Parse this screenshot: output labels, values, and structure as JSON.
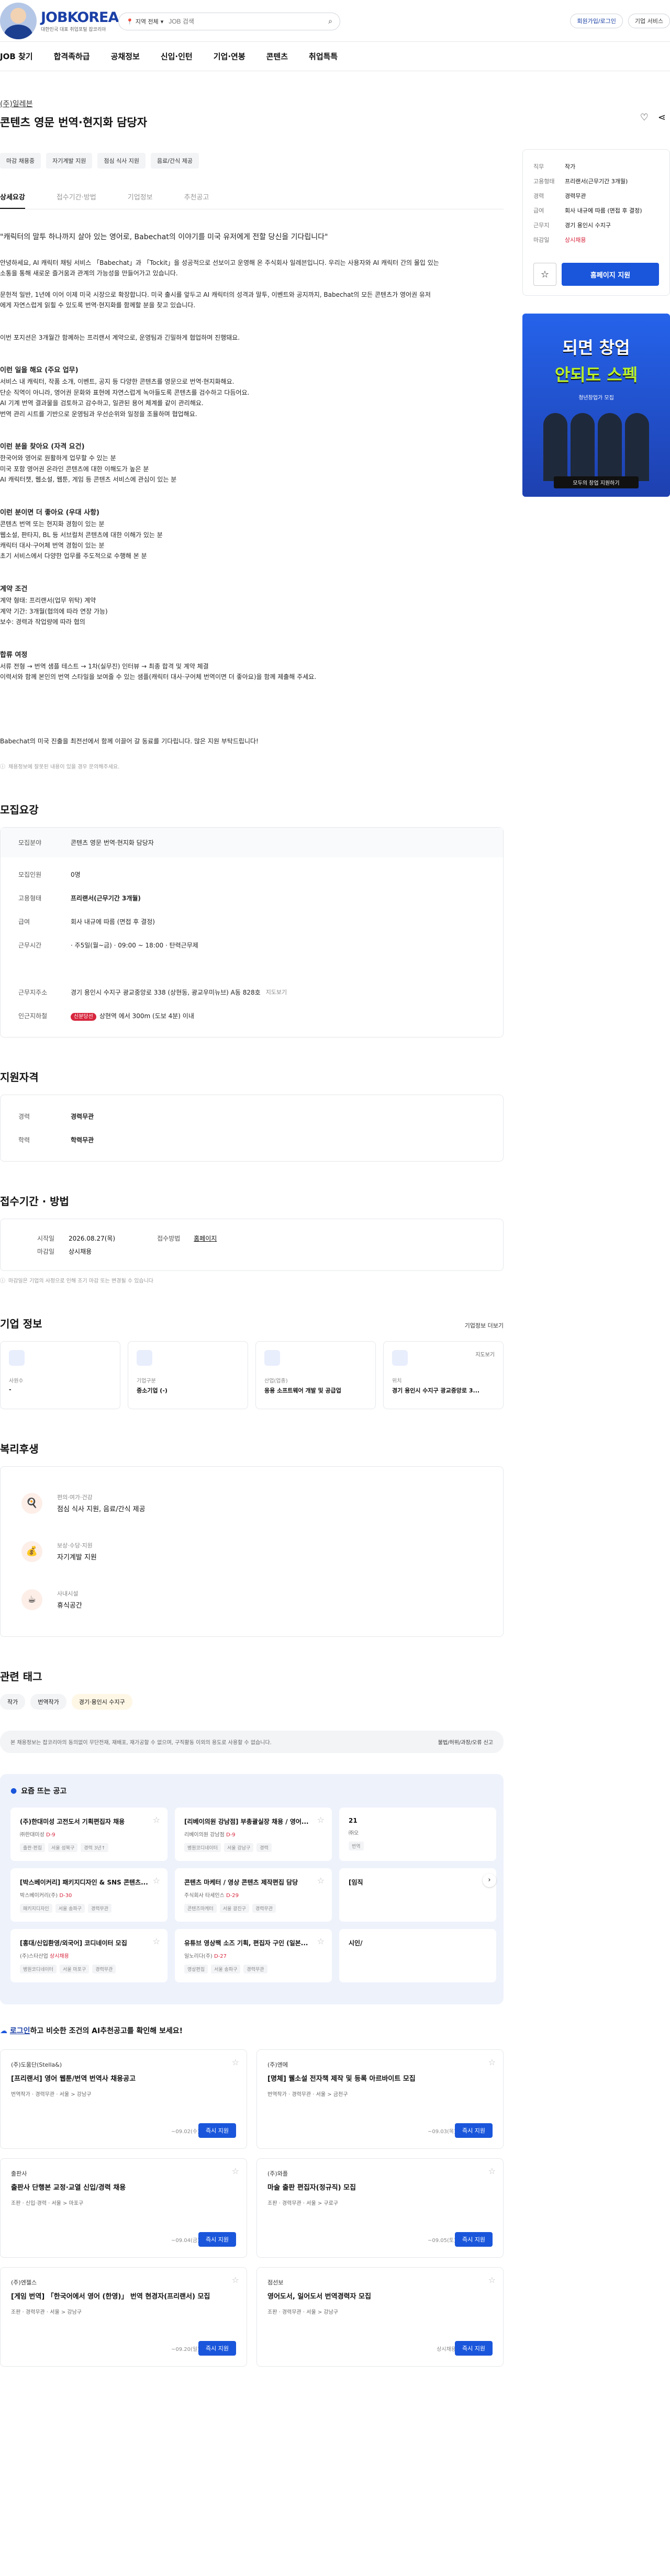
{
  "header": {
    "logo": "JOBKOREA",
    "logo_sub": "대한민국 대표 취업포털 잡코리아",
    "region": "지역 전체",
    "search_placeholder": "JOB 검색",
    "btn_employer": "회원가입/로그인",
    "btn_service": "기업 서비스"
  },
  "nav": [
    "JOB 찾기",
    "합격족하급",
    "공채정보",
    "신입·인턴",
    "기업·연봉",
    "콘텐츠",
    "취업특특"
  ],
  "job": {
    "company": "(주)일레븐",
    "title": "콘텐츠 영문 번역·현지화 담당자",
    "tags": [
      "마감 채용중",
      "자기계발 지원",
      "점심 식사 지원",
      "음료/간식 제공"
    ]
  },
  "tabs": [
    "상세요강",
    "접수기간·방법",
    "기업정보",
    "추천공고"
  ],
  "detail": {
    "lead": "\"캐릭터의 말투 하나까지 살아 있는 영어로, Babechat의 이야기를 미국 유저에게 전할 당신을 기다립니다\"",
    "p1": [
      "안녕하세요, AI 캐릭터 채팅 서비스 「Babechat」과 「Tockit」을 성공적으로 선보이고 운영해 온 주식회사 일레븐입니다. 우리는 사용자와 AI 캐릭터 간의 몰입 있는",
      "소통을 통해 새로운 즐거움과 관계의 가능성을 만들어가고 있습니다."
    ],
    "p2": [
      "문헌적 일반, 1년에 이어 이제 미국 시장으로 확장합니다. 미국 출시를 앞두고 AI 캐릭터의 성격과 말투, 이벤트와 공지까지, Babechat의 모든 콘텐츠가 영어권 유저",
      "에게 자연스럽게 읽힐 수 있도록 번역·현지화를 함께할 분을 찾고 있습니다."
    ],
    "p3": "이번 포지션은 3개월간 함께하는 프리랜서 계약으로, 운영팀과 긴밀하게 협업하며 진행돼요.",
    "h1": "이런 일을 해요 (주요 업무)",
    "l1": [
      "서비스 내 캐릭터, 작품 소개, 이벤트, 공지 등 다양한 콘텐츠를 영문으로 번역·현지화해요.",
      "단순 직역이 아니라, 영어권 문화와 표현에 자연스럽게 녹아들도록 콘텐츠를 검수하고 다듬어요.",
      "AI 기계 번역 결과물을 검토하고 감수하고, 일관된 용어 체계를 같이 관리해요.",
      "번역 관리 시트를 기반으로 운영팀과 우선순위와 일정을 조율하며 협업해요."
    ],
    "h2": "이런 분을 찾아요 (자격 요건)",
    "l2": [
      "한국어와 영어로 원활하게 업무할 수 있는 분",
      "미국 포함 영어권 온라인 콘텐츠에 대한 이해도가 높은 분",
      "AI 캐릭터챗, 웹소설, 웹툰, 게임 등 콘텐츠 서비스에 관심이 있는 분"
    ],
    "h3": "이런 분이면 더 좋아요 (우대 사항)",
    "l3": [
      "콘텐츠 번역 또는 현지화 경험이 있는 분",
      "웹소설, 판타지, BL 등 서브컬처 콘텐츠에 대한 이해가 있는 분",
      "캐릭터 대사·구어체 번역 경험이 있는 분",
      "초기 서비스에서 다양한 업무를 주도적으로 수행해 본 분"
    ],
    "h4": "계약 조건",
    "l4": [
      "계약 형태: 프리랜서(업무 위탁) 계약",
      "계약 기간: 3개월(협의에 따라 연장 가능)",
      "보수: 경력과 작업량에 따라 협의"
    ],
    "h5": "합류 여정",
    "l5": [
      "서류 전형 → 번역 샘플 테스트 → 1차(실무진) 인터뷰 → 최종 합격 및 계약 체결",
      "이력서와 함께 본인의 번역 스타일을 보여줄 수 있는 샘플(캐릭터 대사·구어체 번역이면 더 좋아요)을 함께 제출해 주세요."
    ],
    "closing": "Babechat의 미국 진출을 최전선에서 함께 이끌어 갈 동료를 기다립니다. 많은 지원 부탁드립니다!"
  },
  "notice": "채용정보에 잘못된 내용이 있을 경우 문의해주세요.",
  "recruit": {
    "title": "모집요강",
    "rows": [
      {
        "k": "모집분야",
        "v": "콘텐츠 영문 번역·현지화 담당자"
      },
      {
        "k": "모집인원",
        "v": "0명"
      },
      {
        "k": "고용형태",
        "v": "프리랜서(근무기간 3개월)"
      },
      {
        "k": "급여",
        "v": "회사 내규에 따름 (면접 후 결정)"
      },
      {
        "k": "근무시간",
        "v": "· 주5일(월~금) · 09:00 ~ 18:00 · 탄력근무제"
      },
      {
        "k": "근무지주소",
        "v": "경기 용인시 수지구 광교중앙로 338 (상현동, 광교우미뉴브) A동 828호"
      },
      {
        "k": "인근지하철",
        "v": "상현역 에서 300m (도보 4분) 이내"
      }
    ],
    "map_label": "지도보기",
    "subway_badge": "신분당선"
  },
  "qual": {
    "title": "지원자격",
    "rows": [
      {
        "k": "경력",
        "v": "경력무관"
      },
      {
        "k": "학력",
        "v": "학력무관"
      }
    ]
  },
  "period": {
    "title": "접수기간 · 방법",
    "start_label": "시작일",
    "start": "2026.08.27(목)",
    "end_label": "마감일",
    "end": "상시채용",
    "method_label": "접수방법",
    "method": "홈페이지"
  },
  "period_notice": "마감일은 기업의 사정으로 인해 조기 마감 또는 변경될 수 있습니다",
  "company": {
    "title": "기업 정보",
    "more": "기업정보 더보기",
    "cards": [
      {
        "l": "사원수",
        "v": "-"
      },
      {
        "l": "기업구분",
        "v": "중소기업 (-)"
      },
      {
        "l": "산업(업종)",
        "v": "응용 소프트웨어 개발 및 공급업"
      },
      {
        "l": "위치",
        "v": "경기 용인시 수지구 광교중앙로 3..."
      }
    ],
    "map_label": "지도보기"
  },
  "welfare": {
    "title": "복리후생",
    "items": [
      {
        "l": "편의·여가·건강",
        "v": "점심 식사 지원, 음료/간식 제공",
        "icon": "🍳"
      },
      {
        "l": "보상·수당·지원",
        "v": "자기계발 지원",
        "icon": "💰"
      },
      {
        "l": "사내시설",
        "v": "휴식공간",
        "icon": "☕"
      }
    ]
  },
  "related": {
    "title": "관련 태그",
    "tags": [
      "작가",
      "번역작가",
      "경기·용인시 수지구"
    ]
  },
  "banner": {
    "text": "본 채용정보는 잡코리아의 동의없이 무단전재, 재배포, 재가공할 수 없으며, 구직활동 이외의 용도로 사용할 수 없습니다.",
    "link": "불법/허위/과장/오류 신고"
  },
  "rec": {
    "title": "요즘 뜨는 공고",
    "items": [
      {
        "t": "(주)한대미성 고전도서 기획편집자 채용",
        "c": "㈜한대미성",
        "d": "D-9",
        "m": [
          "출판·편집",
          "서울 성북구",
          "경력 3년↑"
        ]
      },
      {
        "t": "[리베이의원 강남점] 부총괄실장 채용 / 영어...",
        "c": "리베이의원 강남점",
        "d": "D-9",
        "m": [
          "병원코디네이터",
          "서울 강남구",
          "경력"
        ]
      },
      {
        "t": "21",
        "c": "㈜오",
        "d": "",
        "m": [
          "번역"
        ]
      },
      {
        "t": "[박스베이커리] 패키지디자인 & SNS 콘텐츠...",
        "c": "박스베이커리(주)",
        "d": "D-30",
        "m": [
          "패키지디자인",
          "서울 송파구",
          "경력무관"
        ]
      },
      {
        "t": "콘텐츠 마케터 / 영상 콘텐츠 제작편집 담당",
        "c": "주식회사 타세인스",
        "d": "D-29",
        "m": [
          "콘텐츠마케터",
          "서울 광진구",
          "경력무관"
        ]
      },
      {
        "t": "[임직",
        "c": "",
        "d": "",
        "m": []
      },
      {
        "t": "[홍대/신입환영/외국어] 코디네이터 모집",
        "c": "(주)스타산업",
        "d": "상시채용",
        "m": [
          "병원코디네이터",
          "서울 마포구",
          "경력무관"
        ]
      },
      {
        "t": "유튜브 영상팩 소즈 기획, 편집자 구인 (일본...",
        "c": "일노리다(주)",
        "d": "D-27",
        "m": [
          "영상편집",
          "서울 송파구",
          "경력무관"
        ]
      },
      {
        "t": "시인/",
        "c": "",
        "d": "",
        "m": []
      }
    ]
  },
  "ai": {
    "prefix": "로그인",
    "suffix": "하고 비슷한 조건의 AI추천공고를 확인해 보세요!",
    "items": [
      {
        "c": "(주)도움단(Stella&)",
        "t": "[프리랜서] 영어 웹툰/번역 번역사 채용공고",
        "m": "번역작가 · 경력무관 · 서울 > 강남구",
        "d": "~09.02(수)"
      },
      {
        "c": "(주)엔에",
        "t": "[명체] 웰소설 전자책 제작 및 등록 아르바이트 모집",
        "m": "번역작가 · 경력무관 · 서울 > 금천구",
        "d": "~09.03(목)"
      },
      {
        "c": "출판사",
        "t": "출판사 단행본 교정·교열 신입/경력 채용",
        "m": "조판 · 신입·경력 · 서울 > 마포구",
        "d": "~09.04(금)"
      },
      {
        "c": "(주)와플",
        "t": "마술 출판 편집자(정규직) 모집",
        "m": "조판 · 경력무관 · 서울 > 구로구",
        "d": "~09.05(토)"
      },
      {
        "c": "(주)엔젤스",
        "t": "[게임 번역] 「한국어에서 영어 (한영)」 번역 현경자(프리랜서) 모집",
        "m": "조판 · 경력무관 · 서울 > 강남구",
        "d": "~09.20(일)"
      },
      {
        "c": "점선보",
        "t": "영어도서, 일어도서 번역경력자 모집",
        "m": "조판 · 경력무관 · 서울 > 강남구",
        "d": "상시채용"
      }
    ],
    "btn": "즉시 지원"
  },
  "side": {
    "rows": [
      {
        "k": "직무",
        "v": "작가"
      },
      {
        "k": "고용형태",
        "v": "프리랜서(근무기간 3개월)"
      },
      {
        "k": "경력",
        "v": "경력무관"
      },
      {
        "k": "급여",
        "v": "회사 내규에 따름 (면접 후 결정)"
      },
      {
        "k": "근무지",
        "v": "경기 용인시 수지구"
      },
      {
        "k": "마감일",
        "v": "상시채용"
      }
    ],
    "apply": "홈페이지 지원"
  },
  "ad": {
    "l1": "되면 창업",
    "l2": "안되도 스펙",
    "l3": "청년창업가 모집",
    "l4": "모두의 창업 지원하기"
  },
  "colors": {
    "brand": "#1a3fa6",
    "apply": "#1a56db",
    "deadline": "#d7263d"
  }
}
